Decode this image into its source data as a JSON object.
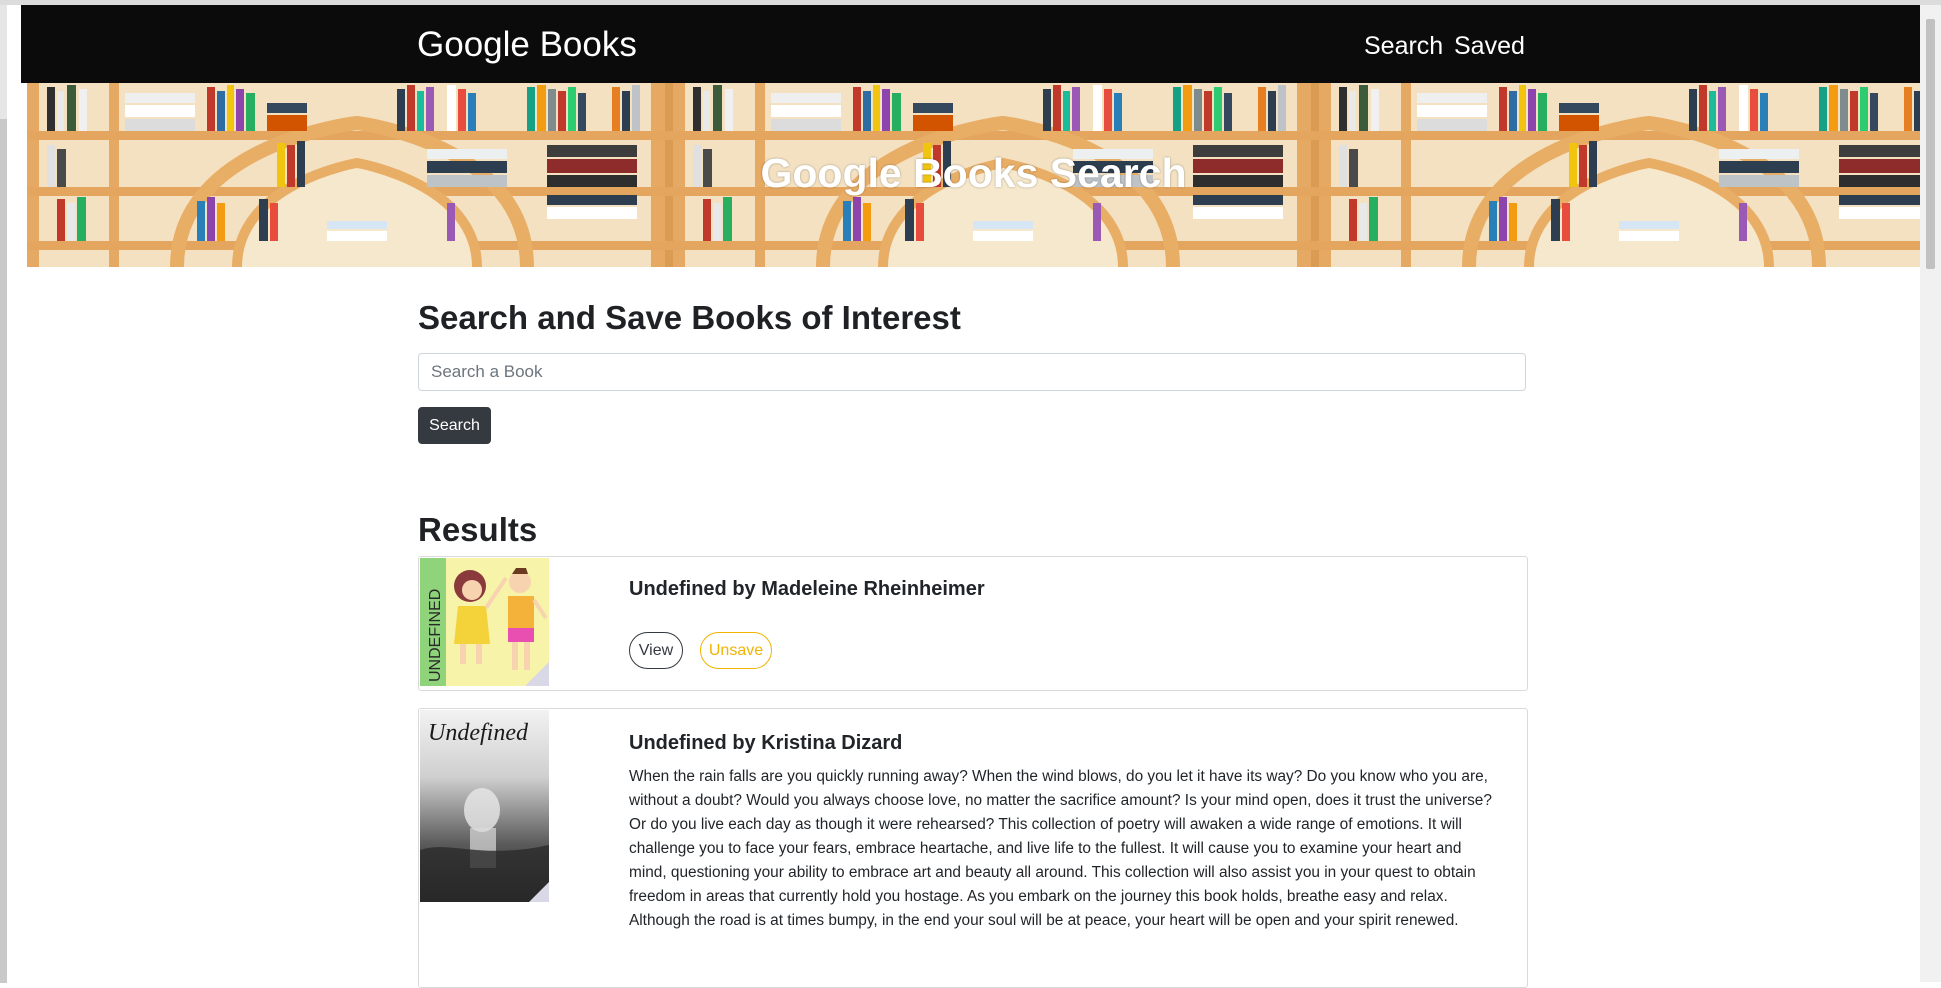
{
  "navbar": {
    "brand": "Google Books",
    "links": {
      "search": "Search",
      "saved": "Saved"
    }
  },
  "hero": {
    "title": "Google Books Search"
  },
  "search_section": {
    "heading": "Search and Save Books of Interest",
    "input_placeholder": "Search a Book",
    "input_value": "",
    "button_label": "Search"
  },
  "results": {
    "heading": "Results",
    "books": [
      {
        "title": "Undefined by Madeleine Rheinheimer",
        "cover_text": "UNDEFINED",
        "view_label": "View",
        "save_label": "Unsave"
      },
      {
        "title": "Undefined by Kristina Dizard",
        "cover_text": "Undefined",
        "description": "When the rain falls are you quickly running away? When the wind blows, do you let it have its way? Do you know who you are, without a doubt? Would you always choose love, no matter the sacrifice amount? Is your mind open, does it trust the universe? Or do you live each day as though it were rehearsed? This collection of poetry will awaken a wide range of emotions. It will challenge you to face your fears, embrace heartache, and live life to the fullest. It will cause you to examine your heart and mind, questioning your ability to embrace art and beauty all around. This collection will also assist you in your quest to obtain freedom in areas that currently hold you hostage. As you embark on the journey this book holds, breathe easy and relax. Although the road is at times bumpy, in the end your soul will be at peace, your heart will be open and your spirit renewed."
      }
    ]
  },
  "colors": {
    "navbar_bg": "#0b0b0c",
    "dark_button": "#343a40",
    "unsave_accent": "#f0b400",
    "shelf_wood": "#e0a55a"
  }
}
